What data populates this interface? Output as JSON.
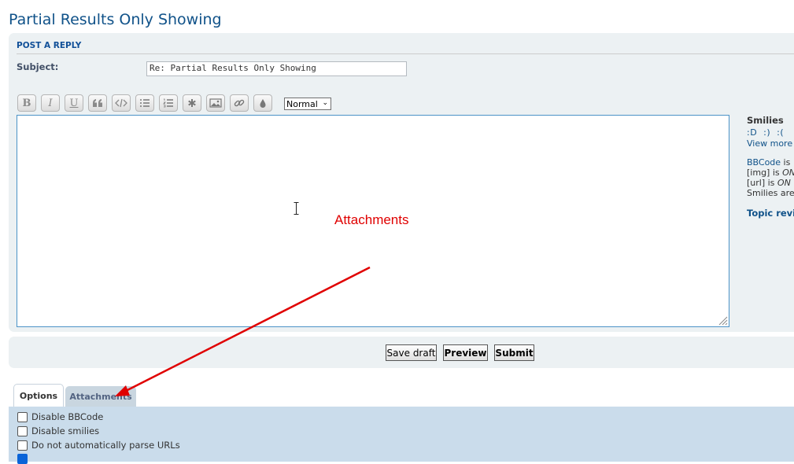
{
  "page": {
    "title": "Partial Results Only Showing"
  },
  "post_panel": {
    "heading": "POST A REPLY",
    "subject_label": "Subject:",
    "subject_value": "Re: Partial Results Only Showing",
    "toolbar": {
      "bold": "B",
      "italic": "I",
      "underline": "U",
      "font_size_value": "Normal"
    },
    "message_value": ""
  },
  "sidebar": {
    "smilies_title": "Smilies",
    "smilies": ":D  :)  :(",
    "view_more": "View more",
    "bbcode_link": "BBCode",
    "bbcode_rest": " is",
    "img_label": "[img] is ",
    "img_state": "ON",
    "url_label": "[url] is ",
    "url_state": "ON",
    "smilies_status": "Smilies are",
    "topic_review": "Topic revi"
  },
  "annotation": {
    "text": "Attachments",
    "color": "#e00000"
  },
  "submit_panel": {
    "save_draft": "Save draft",
    "preview": "Preview",
    "submit": "Submit"
  },
  "tabs": {
    "options": "Options",
    "attachments": "Attachments"
  },
  "options": [
    {
      "label": "Disable BBCode",
      "checked": false
    },
    {
      "label": "Disable smilies",
      "checked": false
    },
    {
      "label": "Do not automatically parse URLs",
      "checked": false
    },
    {
      "label": "",
      "checked": true
    }
  ],
  "colors": {
    "accent": "#105289",
    "panel": "#ecf1f3",
    "options_bg": "#cadceb"
  }
}
